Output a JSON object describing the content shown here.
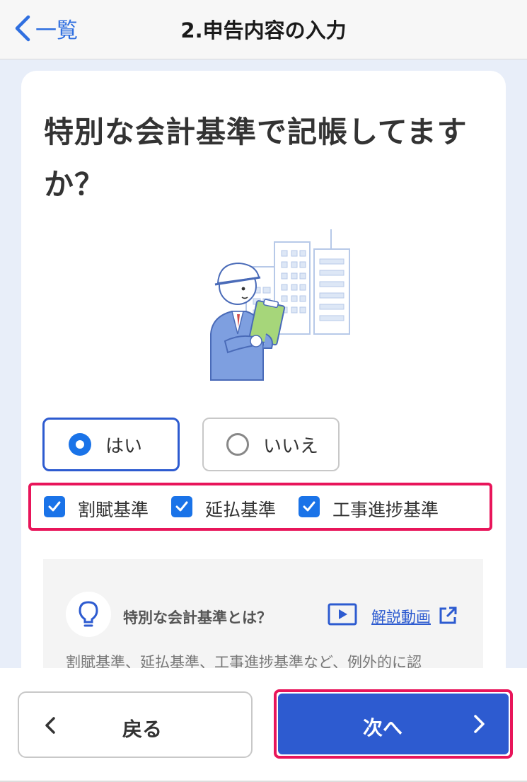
{
  "nav": {
    "back_label": "一覧",
    "title": "2.申告内容の入力"
  },
  "question": {
    "text": "特別な会計基準で記帳してますか？"
  },
  "options": {
    "yes_label": "はい",
    "no_label": "いいえ",
    "selected": "はい"
  },
  "checkboxes": [
    {
      "label": "割賦基準",
      "checked": true
    },
    {
      "label": "延払基準",
      "checked": true
    },
    {
      "label": "工事進捗基準",
      "checked": true
    }
  ],
  "info": {
    "title": "特別な会計基準とは？",
    "video_link": "解説動画",
    "text": "割賦基準、延払基準、工事進捗基準など、例外的に認"
  },
  "footer": {
    "back_label": "戻る",
    "next_label": "次へ"
  },
  "colors": {
    "accent": "#2d5bd0",
    "highlight": "#e8155a",
    "checkbox": "#1a73e8"
  },
  "icons": {
    "back": "chevron-left-icon",
    "bulb": "lightbulb-icon",
    "video": "video-play-icon",
    "external": "external-link-icon"
  }
}
